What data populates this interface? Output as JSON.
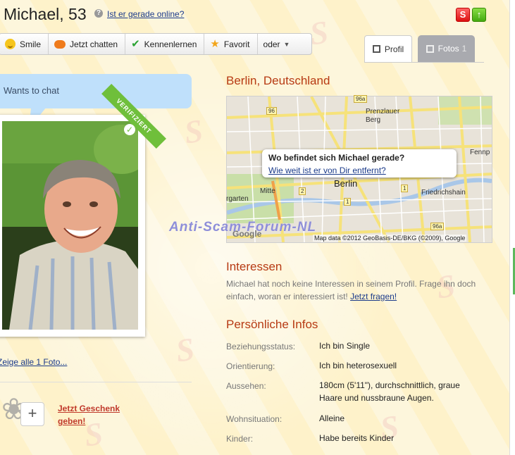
{
  "header": {
    "name": "Michael, 53",
    "help_icon": "?",
    "online_link": "Ist er gerade online?",
    "icons": [
      "s-icon",
      "up-arrow-icon"
    ]
  },
  "toolbar": {
    "items": [
      {
        "label": "Smile",
        "icon": "smile-icon"
      },
      {
        "label": "Jetzt chatten",
        "icon": "chat-bubble-icon"
      },
      {
        "label": "Kennenlernen",
        "icon": "check-icon"
      },
      {
        "label": "Favorit",
        "icon": "star-icon"
      },
      {
        "label": "oder",
        "icon": "chevron-down-icon"
      }
    ]
  },
  "tabs": [
    {
      "label": "Profil",
      "active": true
    },
    {
      "label": "Fotos",
      "count": "1",
      "active": false
    }
  ],
  "left": {
    "status": "Wants to chat",
    "badge": "VERIFIZIERT",
    "photos_link": "Zeige alle 1 Foto...",
    "gift_link": "Jetzt Geschenk geben!",
    "plus": "+"
  },
  "location": {
    "city": "Berlin, Deutschland",
    "popup_question": "Wo befindet sich Michael gerade?",
    "popup_link": "Wie weit ist er von Dir entfernt?",
    "map_labels": {
      "prenzlauer_berg": "Prenzlauer Berg",
      "berlin": "Berlin",
      "mitte": "Mitte",
      "friedrichshain": "Friedrichshain",
      "fennp": "Fennp",
      "garten": "rgarten",
      "road_96": "96",
      "road_96a": "96a",
      "road_2": "2",
      "road_1a": "1",
      "road_1b": "1",
      "road_96a_b": "96a"
    },
    "map_credit": "Map data ©2012 GeoBasis-DE/BKG (©2009), Google",
    "map_logo": "Google"
  },
  "watermark": "Anti-Scam-Forum-NL",
  "interests": {
    "title": "Interessen",
    "text": "Michael hat noch keine Interessen in seinem Profil. Frage ihn doch einfach, woran er interessiert ist!",
    "link": "Jetzt fragen!"
  },
  "infos": {
    "title": "Persönliche Infos",
    "rows": [
      {
        "label": "Beziehungsstatus:",
        "value": "Ich bin Single"
      },
      {
        "label": "Orientierung:",
        "value": "Ich bin heterosexuell"
      },
      {
        "label": "Aussehen:",
        "value": "180cm (5'11\"), durchschnittlich, graue Haare und nussbraune Augen."
      },
      {
        "label": "Wohnsituation:",
        "value": "Alleine"
      },
      {
        "label": "Kinder:",
        "value": "Habe bereits Kinder"
      }
    ]
  },
  "colors": {
    "heading": "#b73a13",
    "link": "#1a3a8a",
    "bubble": "#bfe0fb",
    "badge": "#6fbf3b"
  }
}
